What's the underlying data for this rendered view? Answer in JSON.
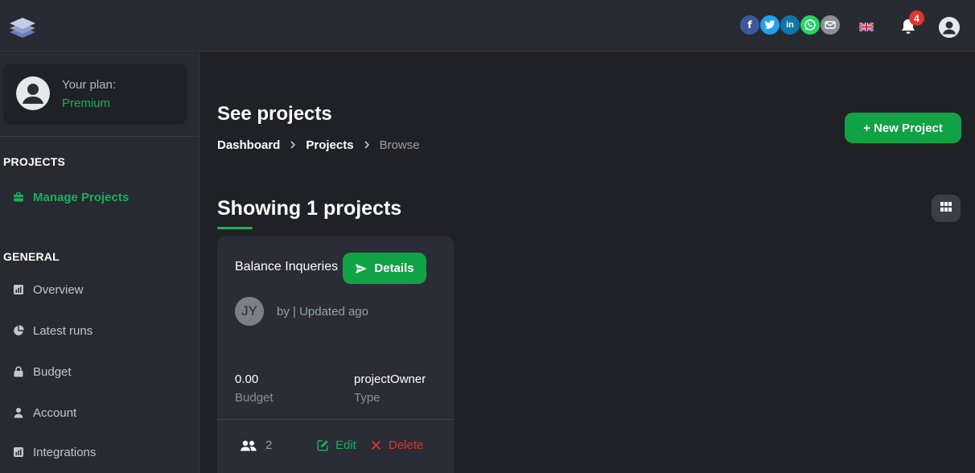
{
  "header": {
    "social": {
      "facebook": "f",
      "linkedin": "in"
    },
    "notifications_count": "4"
  },
  "sidebar": {
    "plan_label": "Your plan:",
    "plan_value": "Premium",
    "sections": {
      "projects": {
        "title": "PROJECTS",
        "items": [
          {
            "label": "Manage Projects",
            "icon": "briefcase-icon",
            "active": true
          }
        ]
      },
      "general": {
        "title": "GENERAL",
        "items": [
          {
            "label": "Overview",
            "icon": "chart-bar-icon"
          },
          {
            "label": "Latest runs",
            "icon": "pie-chart-icon"
          },
          {
            "label": "Budget",
            "icon": "lock-icon"
          },
          {
            "label": "Account",
            "icon": "user-icon"
          },
          {
            "label": "Integrations",
            "icon": "chart-bar-icon"
          }
        ]
      }
    }
  },
  "main": {
    "title": "See projects",
    "breadcrumb": [
      "Dashboard",
      "Projects",
      "Browse"
    ],
    "new_project_label": "+  New Project",
    "showing_label": "Showing 1 projects",
    "project_card": {
      "name": "Balance Inqueries",
      "details_label": "Details",
      "avatar_initials": "JY",
      "meta": "by | Updated ago",
      "budget_value": "0.00",
      "budget_label": "Budget",
      "type_value": "projectOwner",
      "type_label": "Type",
      "members_count": "2",
      "edit_label": "Edit",
      "delete_label": "Delete"
    }
  },
  "colors": {
    "accent_green": "#19b157",
    "button_green": "#0fa345",
    "danger_red": "#e0332c",
    "background": "#1f2127",
    "panel": "#272a31"
  }
}
